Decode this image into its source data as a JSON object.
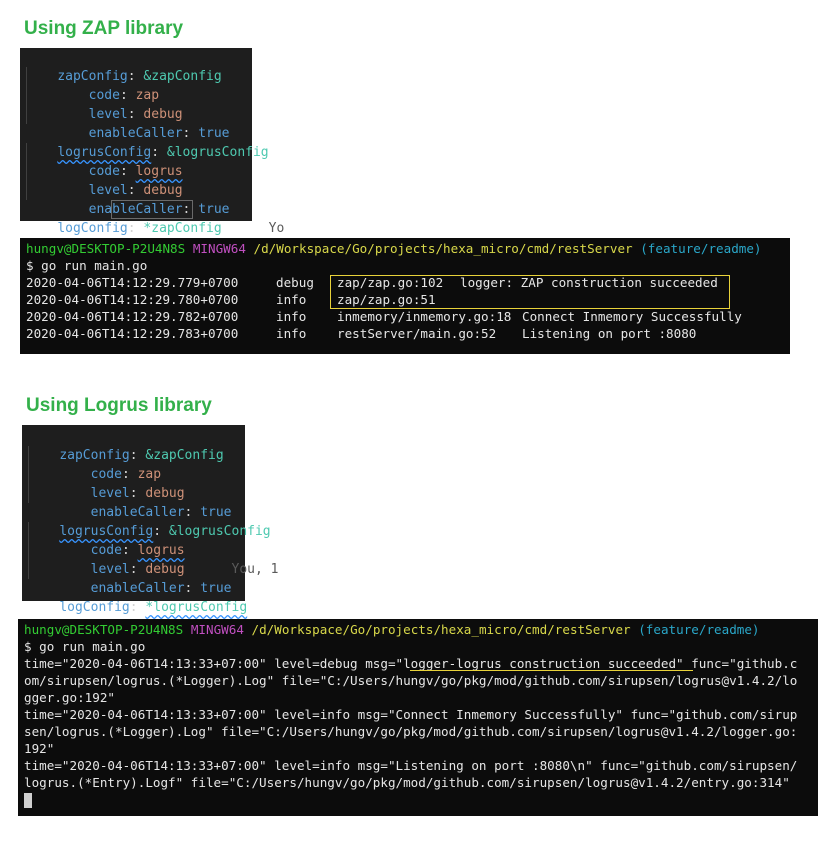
{
  "zap_section": {
    "heading": "Using ZAP library",
    "code_lines": [
      {
        "key": "zapConfig",
        "sep": ": ",
        "anchor": "&zapConfig"
      },
      {
        "key": "code",
        "sep": ": ",
        "val": "zap"
      },
      {
        "key": "level",
        "sep": ": ",
        "val": "debug"
      },
      {
        "key": "enableCaller",
        "sep": ": ",
        "val": "true"
      },
      {
        "key": "logrusConfig",
        "sep": ": ",
        "anchor": "&logrusConfig"
      },
      {
        "key": "code",
        "sep": ": ",
        "val": "logrus"
      },
      {
        "key": "level",
        "sep": ": ",
        "val": "debug"
      },
      {
        "key": "enableCaller",
        "sep": ": ",
        "val": "true"
      },
      {
        "key": "logConfig",
        "sep": ": ",
        "alias": "*zapConfig",
        "ghost": "Yo"
      }
    ],
    "terminal": {
      "prompt_user": "hungv@DESKTOP-P2U4N8S",
      "prompt_sys": "MINGW64",
      "prompt_path": "/d/Workspace/Go/projects/hexa_micro/cmd/restServer",
      "prompt_branch": "(feature/readme)",
      "command": "$ go run main.go",
      "rows": [
        {
          "time": "2020-04-06T14:12:29.779+0700",
          "level": "debug",
          "caller": "zap/zap.go:102",
          "msg": "logger: ZAP construction succeeded"
        },
        {
          "time": "2020-04-06T14:12:29.780+0700",
          "level": "info",
          "caller": "zap/zap.go:51",
          "msg": ""
        },
        {
          "time": "2020-04-06T14:12:29.782+0700",
          "level": "info",
          "caller": "inmemory/inmemory.go:18",
          "msg": "Connect Inmemory Successfully"
        },
        {
          "time": "2020-04-06T14:12:29.783+0700",
          "level": "info",
          "caller": "restServer/main.go:52",
          "msg": "Listening on port :8080"
        }
      ]
    }
  },
  "logrus_section": {
    "heading": "Using Logrus library",
    "code_lines": [
      {
        "key": "zapConfig",
        "sep": ": ",
        "anchor": "&zapConfig"
      },
      {
        "key": "code",
        "sep": ": ",
        "val": "zap"
      },
      {
        "key": "level",
        "sep": ": ",
        "val": "debug"
      },
      {
        "key": "enableCaller",
        "sep": ": ",
        "val": "true"
      },
      {
        "key": "logrusConfig",
        "sep": ": ",
        "anchor": "&logrusConfig"
      },
      {
        "key": "code",
        "sep": ": ",
        "val": "logrus"
      },
      {
        "key": "level",
        "sep": ": ",
        "val": "debug",
        "ghost": "You, 1"
      },
      {
        "key": "enableCaller",
        "sep": ": ",
        "val": "true"
      },
      {
        "key": "logConfig",
        "sep": ": ",
        "alias": "*logrusConfig"
      }
    ],
    "terminal": {
      "prompt_user": "hungv@DESKTOP-P2U4N8S",
      "prompt_sys": "MINGW64",
      "prompt_path": "/d/Workspace/Go/projects/hexa_micro/cmd/restServer",
      "prompt_branch": "(feature/readme)",
      "command": "$ go run main.go",
      "lines": [
        "time=\"2020-04-06T14:13:33+07:00\" level=debug msg=\"logger-logrus construction succeeded\" func=\"github.c",
        "om/sirupsen/logrus.(*Logger).Log\" file=\"C:/Users/hungv/go/pkg/mod/github.com/sirupsen/logrus@v1.4.2/lo",
        "gger.go:192\"",
        "time=\"2020-04-06T14:13:33+07:00\" level=info msg=\"Connect Inmemory Successfully\" func=\"github.com/sirup",
        "sen/logrus.(*Logger).Log\" file=\"C:/Users/hungv/go/pkg/mod/github.com/sirupsen/logrus@v1.4.2/logger.go:",
        "192\"",
        "time=\"2020-04-06T14:13:33+07:00\" level=info msg=\"Listening on port :8080\\n\" func=\"github.com/sirupsen/",
        "logrus.(*Entry).Logf\" file=\"C:/Users/hungv/go/pkg/mod/github.com/sirupsen/logrus@v1.4.2/entry.go:314\""
      ]
    }
  }
}
